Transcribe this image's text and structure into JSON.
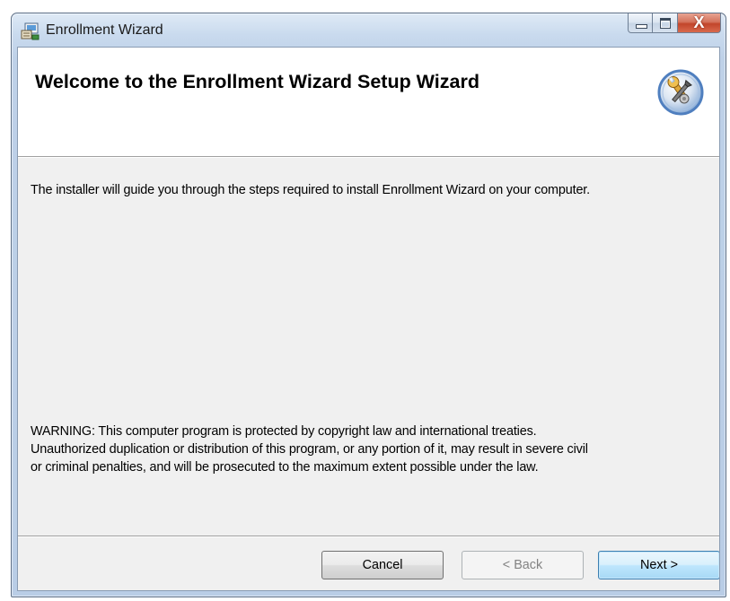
{
  "window": {
    "title": "Enrollment Wizard",
    "close_glyph": "X",
    "icons": {
      "app": "installer-icon",
      "minimize": "minimize-icon",
      "maximize": "maximize-icon",
      "close": "close-icon",
      "banner": "wrench-gear-icon"
    }
  },
  "banner": {
    "title": "Welcome to the Enrollment Wizard Setup Wizard"
  },
  "body": {
    "intro": "The installer will guide you through the steps required to install Enrollment Wizard on your computer.",
    "warning_lines": [
      "WARNING: This computer program is protected by copyright law and international treaties.",
      "Unauthorized duplication or distribution of this program, or any portion of it, may result in severe civil",
      "or criminal penalties, and will be prosecuted to the maximum extent possible under the law."
    ]
  },
  "buttons": {
    "cancel": "Cancel",
    "back": "< Back",
    "next": "Next >"
  },
  "colors": {
    "title_bar": "#c9daee",
    "close_button": "#c2452b",
    "client_background": "#f0f0f0",
    "default_button_border": "#3c7fb1"
  }
}
